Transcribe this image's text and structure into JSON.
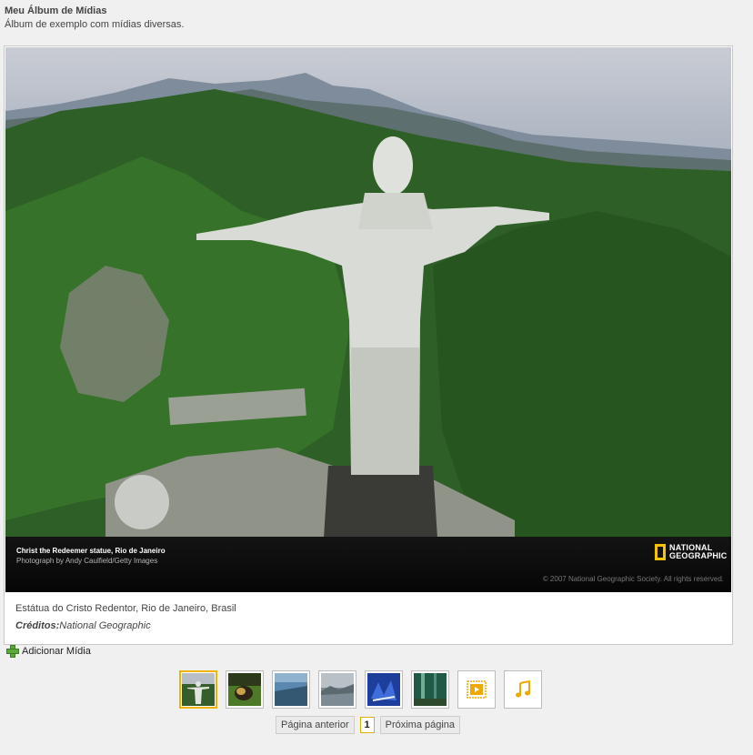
{
  "album": {
    "title": "Meu Álbum de Mídias",
    "description": "Álbum de exemplo com mídias diversas."
  },
  "photo": {
    "caption_title": "Christ the Redeemer statue, Rio de Janeiro",
    "caption_credit": "Photograph by Andy Caulfield/Getty Images",
    "copyright": "© 2007 National Geographic Society. All rights reserved.",
    "logo_line1": "NATIONAL",
    "logo_line2": "GEOGRAPHIC"
  },
  "media": {
    "name": "Estátua do Cristo Redentor, Rio de Janeiro, Brasil",
    "credits_label": "Créditos:",
    "credits_value": "National Geographic"
  },
  "add_media_label": "Adicionar Mídia",
  "thumbnails": [
    {
      "type": "image",
      "icon": "christ-statue-thumbnail"
    },
    {
      "type": "image",
      "icon": "animal-thumbnail"
    },
    {
      "type": "image",
      "icon": "sky-thumbnail"
    },
    {
      "type": "image",
      "icon": "landscape-thumbnail"
    },
    {
      "type": "image",
      "icon": "blue-art-thumbnail"
    },
    {
      "type": "image",
      "icon": "forest-thumbnail"
    },
    {
      "type": "video",
      "icon": "video-icon"
    },
    {
      "type": "audio",
      "icon": "music-note-icon"
    }
  ],
  "pager": {
    "prev_label": "Página anterior",
    "current_page": "1",
    "next_label": "Próxima página"
  },
  "colors": {
    "accent": "#f0b400",
    "logo_yellow": "#f5c400",
    "add_icon": "#5ca83a"
  }
}
